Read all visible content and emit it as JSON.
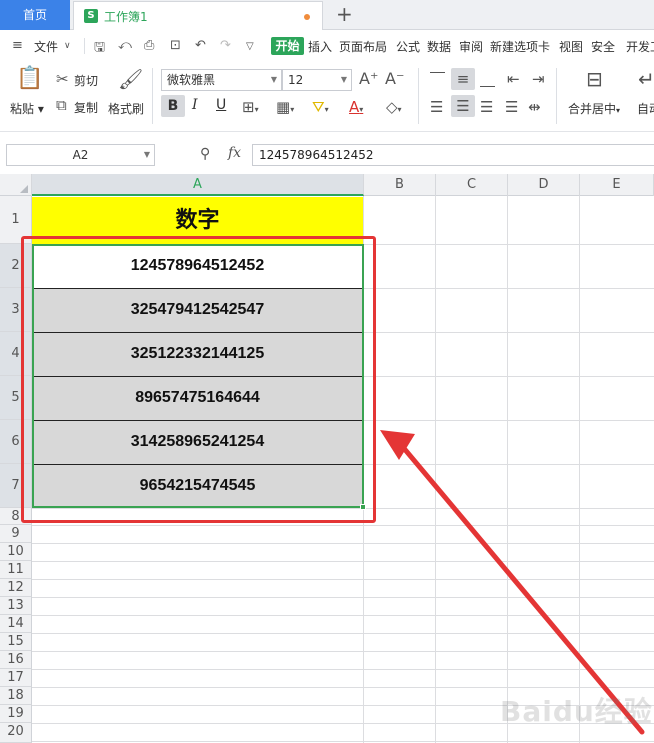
{
  "tabs": {
    "home": "首页",
    "workbook": "工作簿1",
    "workbook_icon": "S",
    "new_tab": "+"
  },
  "menu": {
    "file": "文件",
    "items": [
      "开始",
      "插入",
      "页面布局",
      "公式",
      "数据",
      "审阅",
      "新建选项卡",
      "视图",
      "安全",
      "开发工具"
    ]
  },
  "clipboard": {
    "paste": "粘贴",
    "cut": "剪切",
    "copy": "复制",
    "format_painter": "格式刷"
  },
  "font": {
    "name": "微软雅黑",
    "size": "12",
    "bold": "B",
    "italic": "I",
    "underline": "U"
  },
  "align": {
    "merge_center": "合并居中",
    "auto_wrap": "自动换行"
  },
  "formula_bar": {
    "name_box": "A2",
    "fx": "fx",
    "value": "124578964512452"
  },
  "grid": {
    "columns": [
      "A",
      "B",
      "C",
      "D",
      "E"
    ],
    "selected_column": "A",
    "rows": [
      "1",
      "2",
      "3",
      "4",
      "5",
      "6",
      "7",
      "8",
      "9",
      "10",
      "11",
      "12",
      "13",
      "14",
      "15",
      "16",
      "17",
      "18",
      "19",
      "20"
    ],
    "header_cell": "数字",
    "values": [
      "124578964512452",
      "325479412542547",
      "325122332144125",
      "89657475164644",
      "314258965241254",
      "9654215474545"
    ]
  },
  "colors": {
    "accent": "#2ca55a",
    "header_fill": "#ffff00",
    "highlight_red": "#e43535",
    "selection_green": "#3aa352"
  },
  "watermark": "Baidu经验"
}
